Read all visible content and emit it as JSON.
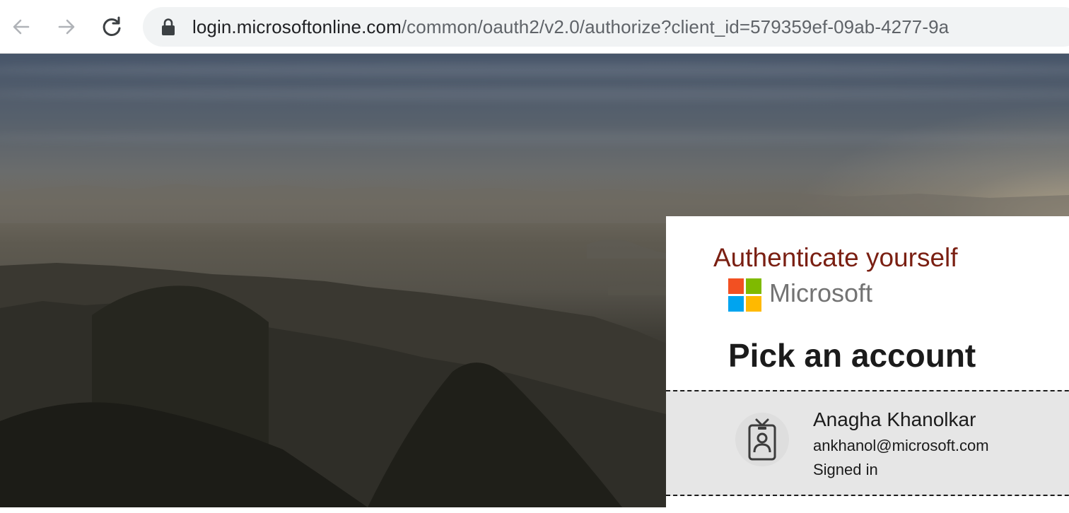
{
  "browser": {
    "url_host": "login.microsoftonline.com",
    "url_path": "/common/oauth2/v2.0/authorize?client_id=579359ef-09ab-4277-9a",
    "icons": {
      "back": "arrow-left-icon",
      "forward": "arrow-right-icon",
      "reload": "reload-icon",
      "lock": "lock-icon"
    }
  },
  "panel": {
    "banner_text": "Authenticate yourself",
    "brand_name": "Microsoft",
    "heading": "Pick an account",
    "logo_colors": [
      "#f25022",
      "#7fba00",
      "#00a4ef",
      "#ffb900"
    ],
    "accent_color": "#7a1f12"
  },
  "account": {
    "name": "Anagha Khanolkar",
    "email": "ankhanol@microsoft.com",
    "status": "Signed in",
    "icon": "person-badge-icon"
  }
}
